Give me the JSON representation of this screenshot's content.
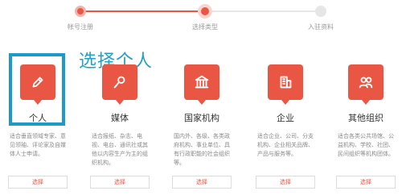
{
  "steps": [
    {
      "label": "帐号注册",
      "state": "done"
    },
    {
      "label": "选择类型",
      "state": "current"
    },
    {
      "label": "入驻资料",
      "state": "todo"
    }
  ],
  "overlay_title": "选择个人",
  "cards": [
    {
      "title": "个人",
      "icon": "pencil-icon",
      "desc": "适合垂直领域专家、意见领袖、评论家及自媒体人士申请。",
      "button": "选择"
    },
    {
      "title": "媒体",
      "icon": "microphone-icon",
      "desc": "适合报纸、杂志、电视、电台、通讯社或其他以内容生产为主的组织机构。",
      "button": "选择"
    },
    {
      "title": "国家机构",
      "icon": "institution-icon",
      "desc": "国内外、各级、各类政府机构、事业单位、具有行政职能的社会组织等。",
      "button": "选择"
    },
    {
      "title": "企业",
      "icon": "building-icon",
      "desc": "适合企业、公司、分支机构、企业相关品牌、产品与服务等。",
      "button": "选择"
    },
    {
      "title": "其他组织",
      "icon": "group-icon",
      "desc": "适合各类公共场馆、公益机构、学校、社团、民间组织等机构团体。",
      "button": "选择"
    }
  ],
  "colors": {
    "accent": "#e95744",
    "highlight": "#1a9bc9",
    "overlay_text": "#23a0c6"
  }
}
